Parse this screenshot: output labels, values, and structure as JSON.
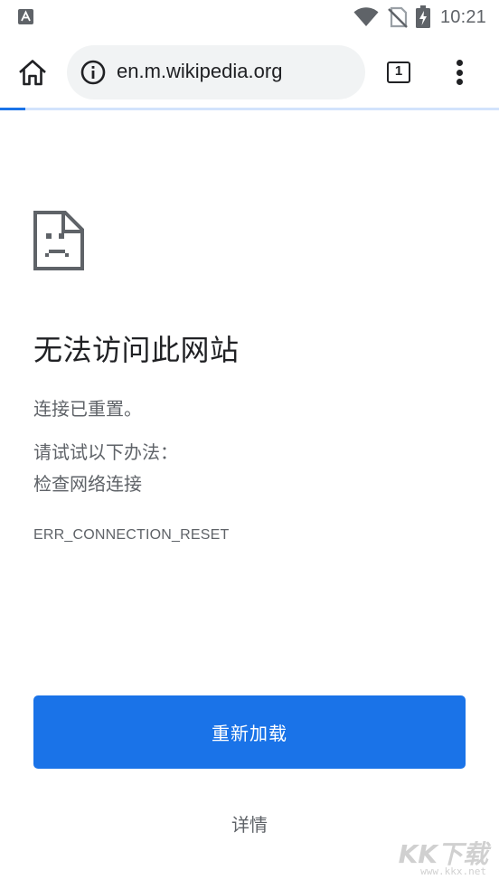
{
  "status_bar": {
    "notification_icon": "a-box-icon",
    "icons": [
      "wifi-icon",
      "no-sim-icon",
      "battery-charging-icon"
    ],
    "time": "10:21"
  },
  "toolbar": {
    "home_icon": "home-icon",
    "omnibox": {
      "icon": "info-icon",
      "url": "en.m.wikipedia.org"
    },
    "tab_count": "1",
    "menu_icon": "more-vert-icon"
  },
  "page_load_progress": 0.05,
  "error_page": {
    "icon": "sad-page-icon",
    "title": "无法访问此网站",
    "subtitle": "连接已重置。",
    "suggestions_heading": "请试试以下办法：",
    "suggestions": [
      "检查网络连接"
    ],
    "error_code": "ERR_CONNECTION_RESET",
    "reload_label": "重新加载",
    "details_label": "详情"
  },
  "watermark": {
    "logo": "KK下载",
    "url": "www.kkx.net"
  },
  "colors": {
    "accent": "#1a73e8",
    "text_primary": "#202124",
    "text_secondary": "#5f6368",
    "omnibox_bg": "#f1f3f4"
  }
}
